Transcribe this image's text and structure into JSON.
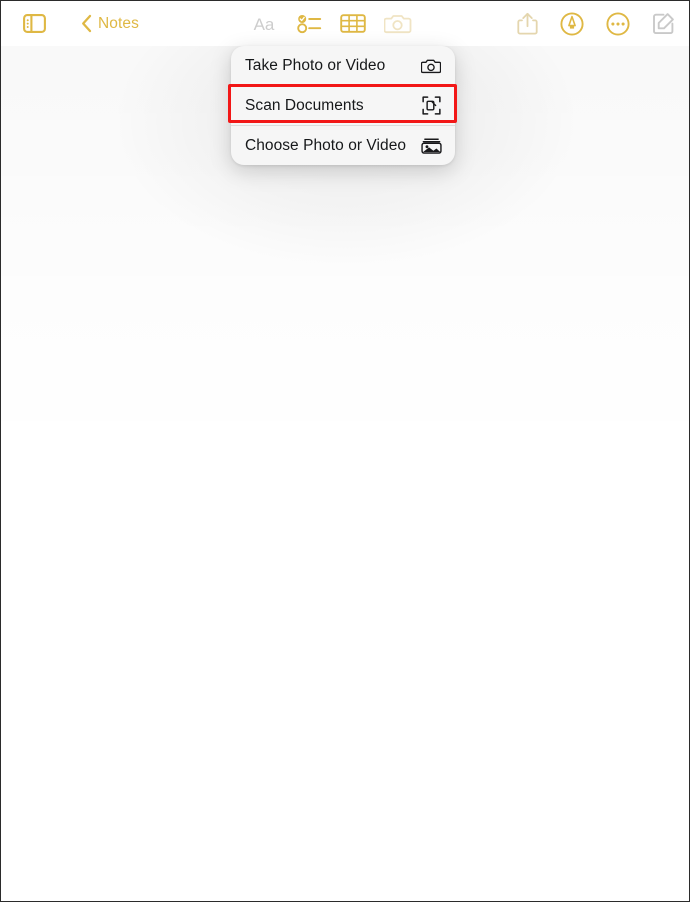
{
  "app": {
    "name": "Notes"
  },
  "toolbar": {
    "left": [
      {
        "name": "sidebar-toggle",
        "icon": "sidebar-icon",
        "label": "",
        "state": "enabled"
      },
      {
        "name": "back-to-notes",
        "icon": "chevron-left-icon",
        "label": "Notes",
        "state": "enabled"
      }
    ],
    "back_label": "Notes",
    "center": [
      {
        "name": "format-text",
        "icon": "aa-format-icon",
        "state": "disabled"
      },
      {
        "name": "checklist",
        "icon": "checklist-icon",
        "state": "enabled"
      },
      {
        "name": "table",
        "icon": "table-icon",
        "state": "enabled"
      },
      {
        "name": "camera",
        "icon": "camera-icon",
        "state": "active"
      }
    ],
    "right": [
      {
        "name": "share",
        "icon": "share-icon",
        "state": "dimmed"
      },
      {
        "name": "markup",
        "icon": "markup-pen-circle-icon",
        "state": "enabled"
      },
      {
        "name": "more-options",
        "icon": "ellipsis-circle-icon",
        "state": "enabled"
      },
      {
        "name": "compose-new-note",
        "icon": "compose-icon",
        "state": "disabled"
      }
    ]
  },
  "menu": {
    "name": "camera-attachment-menu",
    "items": [
      {
        "label": "Take Photo or Video",
        "icon": "camera-icon",
        "highlighted": false
      },
      {
        "label": "Scan Documents",
        "icon": "document-scanner-icon",
        "highlighted": true
      },
      {
        "label": "Choose Photo or Video",
        "icon": "photo-library-icon",
        "highlighted": false
      }
    ]
  },
  "annotation": {
    "highlight_target": "Scan Documents",
    "highlight_color": "#f21717"
  },
  "colors": {
    "accent_gold": "#dfb844",
    "accent_gold_dim": "#eddcab",
    "disabled_grey": "#c9c9c9",
    "menu_background": "#f6f6f6",
    "menu_text": "#16181a",
    "page_background": "#ffffff"
  }
}
